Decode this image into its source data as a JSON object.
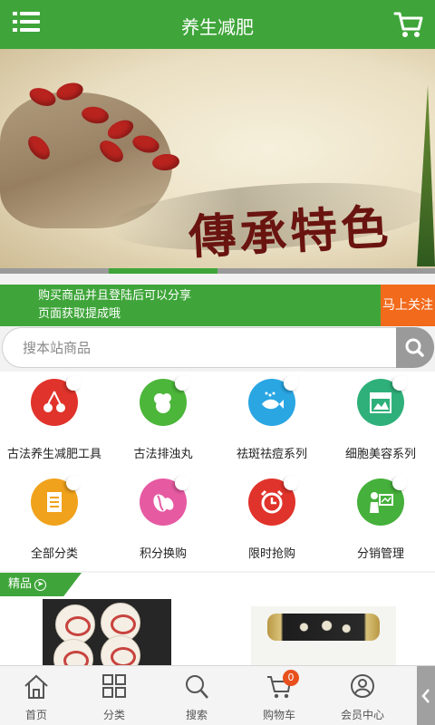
{
  "header": {
    "title": "养生减肥"
  },
  "promo": {
    "line1": "购买商品并且登陆后可以分享",
    "line2": "页面获取提成哦",
    "follow": "马上关注"
  },
  "search": {
    "placeholder": "搜本站商品"
  },
  "banner": {
    "calligraphy": "傳承特色",
    "slide_index": 2,
    "slide_count": 4
  },
  "categories": [
    {
      "label": "古法养生减肥工具",
      "icon": "cherry-icon",
      "color": "#e0332b"
    },
    {
      "label": "古法排浊丸",
      "icon": "herb-icon",
      "color": "#4cb63a"
    },
    {
      "label": "祛斑祛痘系列",
      "icon": "fish-icon",
      "color": "#2aa6e3"
    },
    {
      "label": "细胞美容系列",
      "icon": "shop-icon",
      "color": "#2fb07a"
    },
    {
      "label": "全部分类",
      "icon": "list-icon",
      "color": "#f0a21c"
    },
    {
      "label": "积分换购",
      "icon": "coffee-bean-icon",
      "color": "#e65aa2"
    },
    {
      "label": "限时抢购",
      "icon": "alarm-clock-icon",
      "color": "#e0332b"
    },
    {
      "label": "分销管理",
      "icon": "presenter-icon",
      "color": "#45b03b"
    }
  ],
  "boutique": {
    "label": "精品"
  },
  "bottom_nav": [
    {
      "label": "首页",
      "icon": "home-icon"
    },
    {
      "label": "分类",
      "icon": "grid-icon"
    },
    {
      "label": "搜索",
      "icon": "search-icon"
    },
    {
      "label": "购物车",
      "icon": "cart-icon",
      "badge": "0"
    },
    {
      "label": "会员中心",
      "icon": "user-icon"
    }
  ],
  "colors": {
    "brand": "#3fa53a",
    "accent": "#f26a1b"
  }
}
